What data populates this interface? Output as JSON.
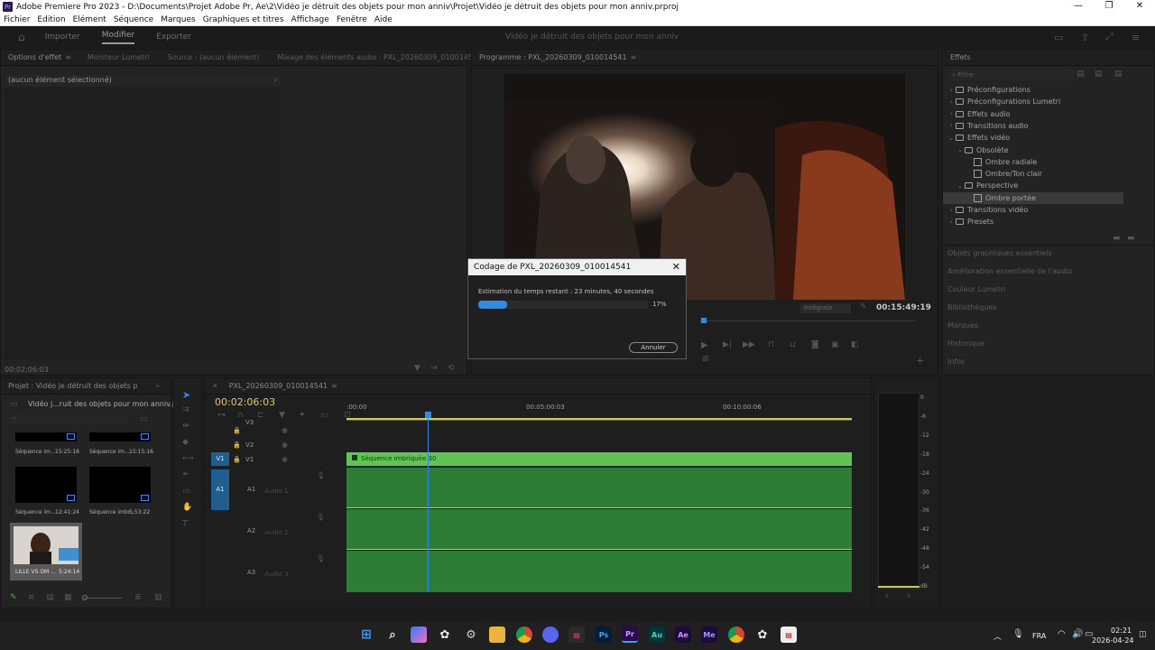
{
  "window": {
    "title": "Adobe Premiere Pro 2023 - D:\\Documents\\Projet Adobe Pr, Ae\\2\\Vidéo je détruit des objets pour mon anniv\\Projet\\Vidéo je détruit des objets pour mon anniv.prproj",
    "app_badge": "Pr",
    "minimize": "—",
    "maximize": "❐",
    "close": "✕"
  },
  "menu": [
    "Fichier",
    "Edition",
    "Elément",
    "Séquence",
    "Marques",
    "Graphiques et titres",
    "Affichage",
    "Fenêtre",
    "Aide"
  ],
  "workspace": {
    "tabs": [
      "Importer",
      "Modifier",
      "Exporter"
    ],
    "active": "Modifier",
    "project_title": "Vidéo je détruit des objets pour mon anniv"
  },
  "effect_controls": {
    "tabs": [
      "Options d'effet",
      "Moniteur Lumetri",
      "Source : (aucun élément)",
      "Mixage des éléments audio : PXL_20260309_010014541"
    ],
    "no_selection": "(aucun élément sélectionné)",
    "timecode": "00:02:06:03"
  },
  "program": {
    "tab": "Programme : PXL_20260309_010014541",
    "fit": "Intégrale",
    "timecode": "00:15:49:19"
  },
  "dialog": {
    "title": "Codage de PXL_20260309_010014541",
    "estimate": "Estimation du temps restant : 23 minutes, 40 secondes",
    "percent_label": "17%",
    "progress": 0.17,
    "cancel": "Annuler"
  },
  "effects_panel": {
    "title": "Effets",
    "search_placeholder": "Filtre",
    "items": [
      {
        "label": "Préconfigurations",
        "level": 0,
        "type": "folder",
        "expanded": false
      },
      {
        "label": "Préconfigurations Lumetri",
        "level": 0,
        "type": "folder",
        "expanded": false
      },
      {
        "label": "Effets audio",
        "level": 0,
        "type": "folder",
        "expanded": false
      },
      {
        "label": "Transitions audio",
        "level": 0,
        "type": "folder",
        "expanded": false
      },
      {
        "label": "Effets vidéo",
        "level": 0,
        "type": "folder",
        "expanded": true
      },
      {
        "label": "Obsolète",
        "level": 1,
        "type": "folder",
        "expanded": true
      },
      {
        "label": "Ombre radiale",
        "level": 2,
        "type": "effect",
        "expanded": false
      },
      {
        "label": "Ombre/Ton clair",
        "level": 2,
        "type": "effect",
        "expanded": false
      },
      {
        "label": "Perspective",
        "level": 1,
        "type": "folder",
        "expanded": true
      },
      {
        "label": "Ombre portée",
        "level": 2,
        "type": "effect",
        "expanded": false,
        "selected": true
      },
      {
        "label": "Transitions vidéo",
        "level": 0,
        "type": "folder",
        "expanded": false
      },
      {
        "label": "Presets",
        "level": 0,
        "type": "folder",
        "expanded": false
      }
    ],
    "collapsed_sections": [
      "Objets graphiques essentiels",
      "Amélioration essentielle de l'audio",
      "Couleur Lumetri",
      "Bibliothèques",
      "Marques",
      "Historique",
      "Infos"
    ]
  },
  "project": {
    "tab": "Projet : Vidéo je détruit des objets pour mon a",
    "filename": "Vidéo j...ruit des objets pour mon anniv.prproj",
    "clips": [
      {
        "name": "Séquence im...",
        "duration": "15:25:16"
      },
      {
        "name": "Séquence im...",
        "duration": "15:15:16"
      },
      {
        "name": "Séquence im...",
        "duration": "12:41:24"
      },
      {
        "name": "Séquence imbr...",
        "duration": "5:53:22"
      },
      {
        "name": "LILLE VS OM ...",
        "duration": "5:24:14"
      }
    ]
  },
  "timeline": {
    "tab": "PXL_20260309_010014541",
    "timecode": "00:02:06:03",
    "ruler": [
      ":00:00",
      "00:05:00:03",
      "00:10:00:06"
    ],
    "video_tracks": [
      "V3",
      "V2",
      "V1"
    ],
    "audio_tracks": [
      "A1",
      "A2",
      "A3"
    ],
    "audio_names": [
      "Audio 1",
      "Audio 2",
      "Audio 3"
    ],
    "source_v": "V1",
    "source_a": "A1",
    "clip_label": "Séquence imbriquée 30"
  },
  "meter": {
    "scale": [
      "0",
      "-6",
      "-12",
      "-18",
      "-24",
      "-30",
      "-36",
      "-42",
      "-48",
      "-54",
      "dB"
    ],
    "solo_left": "S",
    "solo_right": "S"
  },
  "taskbar": {
    "apps": [
      "Ps",
      "Au",
      "Ae",
      "Me",
      "Pr"
    ],
    "lang": "FRA",
    "time": "02:21",
    "date": "2026-04-24"
  },
  "colors": {
    "accent": "#2d8ceb",
    "clip_green": "#5ec452",
    "audio_green": "#2e7d36"
  }
}
